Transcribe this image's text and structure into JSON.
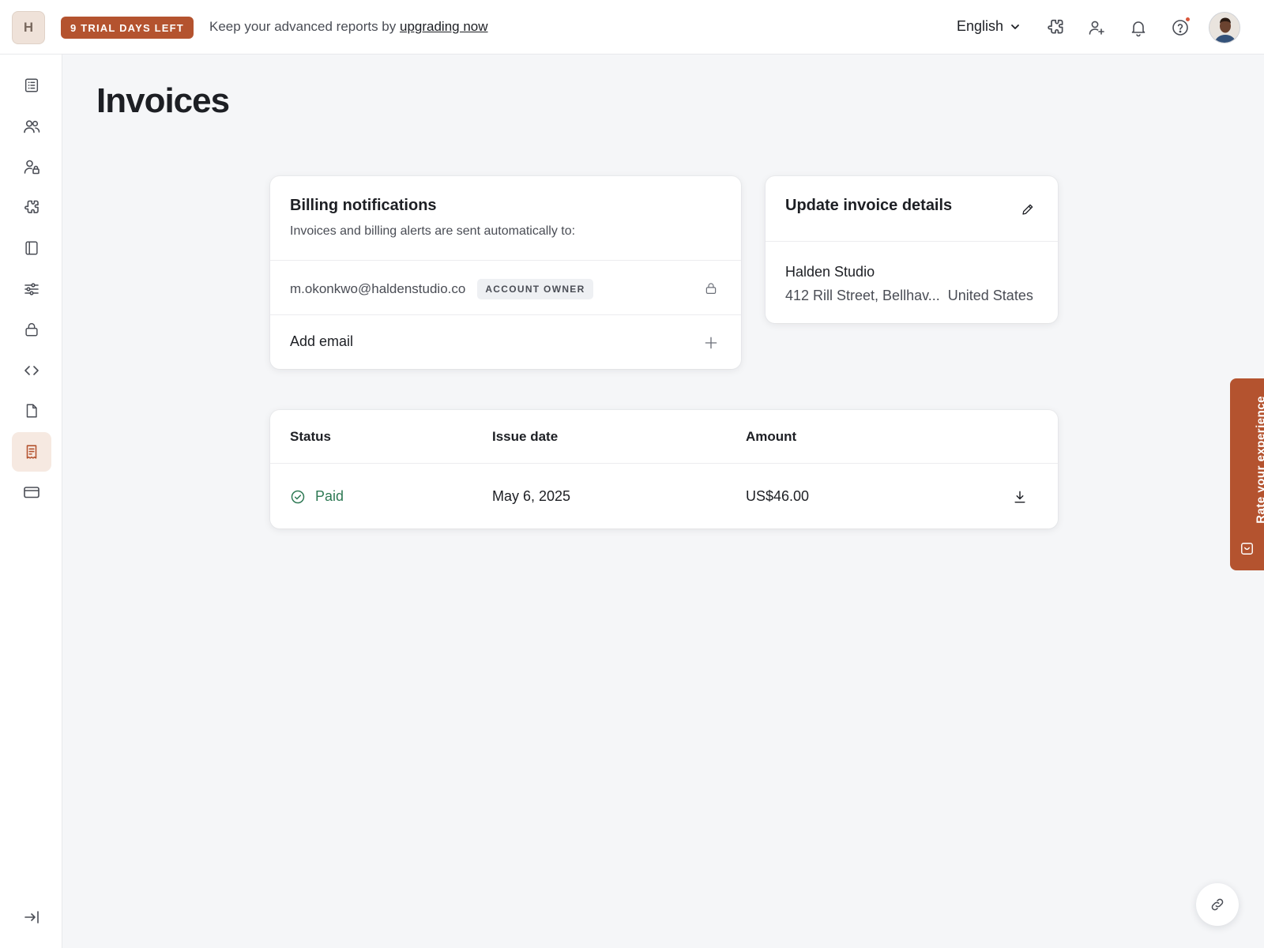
{
  "topbar": {
    "workspace_initial": "H",
    "trial_badge": "9 TRIAL DAYS LEFT",
    "trial_message": "Keep your advanced reports by",
    "trial_link": "upgrading now",
    "language": "English"
  },
  "page": {
    "title": "Invoices"
  },
  "billing": {
    "title": "Billing notifications",
    "subtitle": "Invoices and billing alerts are sent automatically to:",
    "email": "m.okonkwo@haldenstudio.co",
    "email_badge": "ACCOUNT OWNER",
    "add_email": "Add email"
  },
  "invoice_details": {
    "title": "Update invoice details",
    "company": "Halden Studio",
    "street": "412 Rill Street, Bellhav...",
    "country": "United States"
  },
  "invoices_table": {
    "headers": [
      "Status",
      "Issue date",
      "Amount"
    ],
    "rows": [
      {
        "status": "Paid",
        "issue_date": "May 6, 2025",
        "amount": "US$46.00"
      }
    ]
  },
  "feedback": {
    "label": "Rate your experience"
  },
  "colors": {
    "accent": "#b4532f",
    "paid": "#2f7a55"
  }
}
